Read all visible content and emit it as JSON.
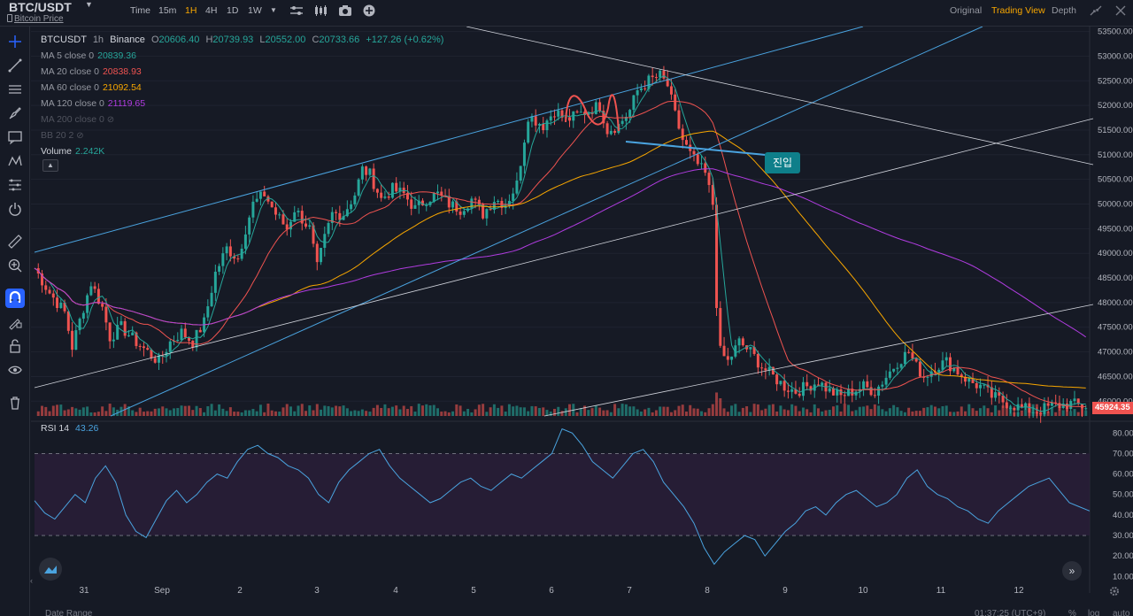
{
  "header": {
    "symbol": "BTC/USDT",
    "subtitle": "Bitcoin Price",
    "timeframes": [
      "Time",
      "15m",
      "1H",
      "4H",
      "1D",
      "1W"
    ],
    "active_timeframe": "1H",
    "views": [
      "Original",
      "Trading View",
      "Depth"
    ],
    "active_view": "Trading View"
  },
  "legend": {
    "pair": "BTCUSDT",
    "interval": "1h",
    "exchange": "Binance",
    "open_label": "O",
    "open": "20606.40",
    "high_label": "H",
    "high": "20739.93",
    "low_label": "L",
    "low": "20552.00",
    "close_label": "C",
    "close": "20733.66",
    "change": "+127.26 (+0.62%)",
    "ma5_label": "MA 5 close 0",
    "ma5": "20839.36",
    "ma20_label": "MA 20 close 0",
    "ma20": "20838.93",
    "ma60_label": "MA 60 close 0",
    "ma60": "21092.54",
    "ma120_label": "MA 120 close 0",
    "ma120": "21119.65",
    "ma200_label": "MA 200 close 0",
    "bb_label": "BB 20 2",
    "volume_label": "Volume",
    "volume": "2.242K"
  },
  "rsi": {
    "label": "RSI 14",
    "value": "43.26"
  },
  "annotation": "진입",
  "last_price": "45924.35",
  "bottom": {
    "date_range": "Date Range",
    "clock": "01:37:25 (UTC+9)",
    "percent": "%",
    "log": "log",
    "auto": "auto"
  },
  "colors": {
    "background": "#161a25",
    "up": "#26a69a",
    "down": "#ef5350",
    "ma5": "#26a69a",
    "ma20": "#ef5350",
    "ma60": "#f7a600",
    "ma120": "#b03ce0",
    "rsi": "#4aa3df"
  },
  "chart_data": {
    "type": "candlestick",
    "x_ticks": [
      "31",
      "Sep",
      "2",
      "3",
      "4",
      "5",
      "6",
      "7",
      "8",
      "9",
      "10",
      "11",
      "12"
    ],
    "price_ticks": [
      "53500.00",
      "53000.00",
      "52500.00",
      "52000.00",
      "51500.00",
      "51000.00",
      "50500.00",
      "50000.00",
      "49500.00",
      "49000.00",
      "48500.00",
      "48000.00",
      "47500.00",
      "47000.00",
      "46500.00",
      "46000.00"
    ],
    "price_range": [
      45700,
      53600
    ],
    "rsi_ticks": [
      "80.00",
      "70.00",
      "60.00",
      "50.00",
      "40.00",
      "30.00",
      "20.00",
      "10.00"
    ],
    "rsi_range": [
      8,
      84
    ],
    "rsi_bands": [
      30,
      70
    ],
    "price_path": [
      [
        0,
        48700
      ],
      [
        4,
        48200
      ],
      [
        8,
        47800
      ],
      [
        10,
        47100
      ],
      [
        13,
        47900
      ],
      [
        15,
        48400
      ],
      [
        18,
        47900
      ],
      [
        20,
        47300
      ],
      [
        23,
        47500
      ],
      [
        27,
        47200
      ],
      [
        30,
        47000
      ],
      [
        33,
        46800
      ],
      [
        36,
        47200
      ],
      [
        39,
        47400
      ],
      [
        42,
        47200
      ],
      [
        45,
        47600
      ],
      [
        48,
        48600
      ],
      [
        51,
        49100
      ],
      [
        54,
        48900
      ],
      [
        56,
        49500
      ],
      [
        58,
        50000
      ],
      [
        61,
        50200
      ],
      [
        64,
        49800
      ],
      [
        67,
        49500
      ],
      [
        69,
        49900
      ],
      [
        71,
        49700
      ],
      [
        73,
        49500
      ],
      [
        75,
        48700
      ],
      [
        77,
        49300
      ],
      [
        79,
        49800
      ],
      [
        82,
        49800
      ],
      [
        85,
        50200
      ],
      [
        87,
        50700
      ],
      [
        89,
        50600
      ],
      [
        92,
        50100
      ],
      [
        95,
        50300
      ],
      [
        98,
        50200
      ],
      [
        101,
        49900
      ],
      [
        104,
        50100
      ],
      [
        107,
        50200
      ],
      [
        110,
        50000
      ],
      [
        113,
        49900
      ],
      [
        116,
        50100
      ],
      [
        119,
        49800
      ],
      [
        122,
        50100
      ],
      [
        125,
        50000
      ],
      [
        128,
        50400
      ],
      [
        131,
        51800
      ],
      [
        133,
        51700
      ],
      [
        135,
        51600
      ],
      [
        138,
        51900
      ],
      [
        141,
        51700
      ],
      [
        144,
        51800
      ],
      [
        147,
        51900
      ],
      [
        150,
        52000
      ],
      [
        152,
        51500
      ],
      [
        155,
        51600
      ],
      [
        158,
        51900
      ],
      [
        160,
        52300
      ],
      [
        163,
        52500
      ],
      [
        166,
        52600
      ],
      [
        168,
        52400
      ],
      [
        170,
        51800
      ],
      [
        172,
        51300
      ],
      [
        174,
        51000
      ],
      [
        176,
        50800
      ],
      [
        178,
        50600
      ],
      [
        180,
        50000
      ],
      [
        181,
        48000
      ],
      [
        182,
        47000
      ],
      [
        184,
        46800
      ],
      [
        187,
        47200
      ],
      [
        190,
        47000
      ],
      [
        193,
        46700
      ],
      [
        196,
        46500
      ],
      [
        199,
        46300
      ],
      [
        202,
        46200
      ],
      [
        205,
        46300
      ],
      [
        208,
        46400
      ],
      [
        211,
        46200
      ],
      [
        214,
        46100
      ],
      [
        217,
        46200
      ],
      [
        220,
        46300
      ],
      [
        223,
        46200
      ],
      [
        226,
        46500
      ],
      [
        229,
        46800
      ],
      [
        232,
        47000
      ],
      [
        234,
        46700
      ],
      [
        236,
        46500
      ],
      [
        239,
        46700
      ],
      [
        242,
        46800
      ],
      [
        245,
        46600
      ],
      [
        248,
        46400
      ],
      [
        251,
        46300
      ],
      [
        254,
        46100
      ],
      [
        257,
        46000
      ],
      [
        262,
        45850
      ],
      [
        266,
        45800
      ],
      [
        270,
        45900
      ],
      [
        275,
        45950
      ],
      [
        278,
        45900
      ]
    ],
    "rsi_values": [
      47,
      41,
      38,
      44,
      50,
      46,
      58,
      64,
      56,
      40,
      32,
      29,
      38,
      47,
      52,
      46,
      50,
      56,
      60,
      58,
      66,
      72,
      74,
      70,
      68,
      64,
      62,
      58,
      50,
      46,
      56,
      62,
      66,
      70,
      72,
      64,
      58,
      54,
      50,
      46,
      48,
      52,
      56,
      58,
      54,
      52,
      56,
      60,
      58,
      62,
      66,
      70,
      82,
      80,
      74,
      66,
      62,
      58,
      64,
      70,
      72,
      66,
      56,
      50,
      44,
      36,
      24,
      16,
      22,
      26,
      30,
      28,
      20,
      26,
      32,
      36,
      42,
      44,
      40,
      46,
      50,
      52,
      48,
      44,
      46,
      50,
      58,
      62,
      54,
      50,
      48,
      44,
      42,
      38,
      36,
      42,
      46,
      50,
      54,
      56,
      58,
      52,
      46,
      44,
      42
    ]
  }
}
